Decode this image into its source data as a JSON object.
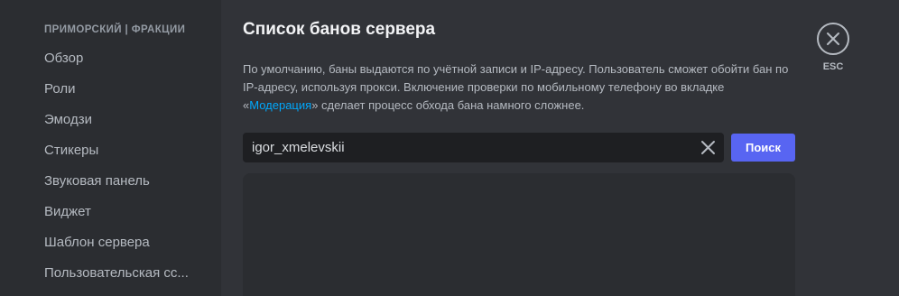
{
  "sidebar": {
    "header": "ПРИМОРСКИЙ | ФРАКЦИИ",
    "items": [
      {
        "label": "Обзор"
      },
      {
        "label": "Роли"
      },
      {
        "label": "Эмодзи"
      },
      {
        "label": "Стикеры"
      },
      {
        "label": "Звуковая панель"
      },
      {
        "label": "Виджет"
      },
      {
        "label": "Шаблон сервера"
      },
      {
        "label": "Пользовательская сс..."
      }
    ]
  },
  "main": {
    "title": "Список банов сервера",
    "description": {
      "part1": "По умолчанию, баны выдаются по учётной записи и IP-адресу. Пользователь сможет обойти бан по IP-адресу, используя прокси. Включение проверки по мобильному телефону во вкладке «",
      "link": "Модерация",
      "part2": "» сделает процесс обхода бана намного сложнее."
    },
    "search": {
      "value": "igor_xmelevskii",
      "button_label": "Поиск"
    }
  },
  "close": {
    "label": "ESC"
  },
  "icons": {
    "clear": "close-icon",
    "close": "close-circle-icon"
  },
  "colors": {
    "accent": "#5865f2",
    "link": "#00a8fc",
    "background": "#313338",
    "sidebar": "#2b2d31",
    "input": "#1e1f22"
  }
}
